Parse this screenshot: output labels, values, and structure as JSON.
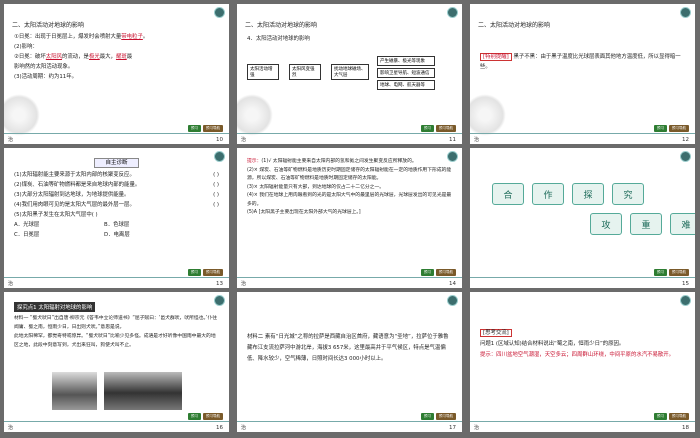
{
  "slides": [
    {
      "num": "10",
      "header": "二、太阳活动对地球的影响",
      "lines": [
        {
          "pre": "②日冕：出现于",
          "mid1": "",
          "post1": "   ，爆发时会喷射大量",
          "blank1": "带电粒子",
          "tail": "。"
        },
        {
          "pre": "(2)影响：",
          "mid1": "",
          "post1": "",
          "blank1": "",
          "tail": ""
        }
      ],
      "line2a": "①日冕：出现于日冕层上，爆发时会喷射大量",
      "line2a_red": "带电粒子",
      "line2b": "。",
      "line3": "(2)影响：",
      "line4a": "①扰乱",
      "line4_red1": "",
      "line4b": "",
      "line5a": "②日冕：破坏",
      "line5_red1": "太阳风",
      "line5b": "的流动，是",
      "line5_red2": "极光",
      "line5c": "最大，",
      "line5_red3": "耀斑",
      "line5d": "最",
      "line6": "影响然的太阳活动现象。",
      "line7": "(3)活动周期：约为11年。"
    },
    {
      "num": "11",
      "header": "二、太阳活动对地球的影响",
      "sub": "4．太阳活动对地球的影响",
      "boxes": [
        "太阳活动增强",
        "太阳风变强烈",
        "扰动地球磁场、大气层",
        "产生磁暴、极光等现象",
        "影响卫星导航、短波通信",
        "地球、电网、航天器等"
      ],
      "reds": [
        "磁暴",
        "短波通信",
        "航天器"
      ]
    },
    {
      "num": "12",
      "header": "二、太阳活动对地球的影响",
      "tag": "[特别提醒]",
      "text": "黑子不黑：由于黑子温度比光球层表面其他地方温度低，所以显得暗一些。"
    },
    {
      "num": "13",
      "title": "自主诊断",
      "items": [
        {
          "q": "(1)太阳辐射能主要来源于太阳内部的核聚变反应。",
          "a": "(   )"
        },
        {
          "q": "(2)煤炭、石油等矿物燃料都是来自地球内部的能量。",
          "a": "(   )"
        },
        {
          "q": "(3)大部分太阳辐射到达地球，为地球提供能量。",
          "a": "(   )"
        },
        {
          "q": "(4)我们用肉眼可见的是太阳大气层的最外层一层。",
          "a": "(   )"
        },
        {
          "q": "(5)太阳黑子发生在太阳大气层中(   )",
          "a": ""
        }
      ],
      "options": [
        "A．光球层",
        "B．色球层",
        "C．日冕层",
        "D．电离层"
      ]
    },
    {
      "num": "14",
      "label": "提示：",
      "paras": [
        "(1)√  太阳辐射能主要来自太阳内部的氢和氦之间发生聚变反应所释放的。",
        "(2)×  煤炭、石油等矿物燃料是地质历史时期固定储存的太阳辐射能在一定的地质作用下形成的能源，所以煤炭、石油等矿物燃料是地质时期固定储存的太阳能。",
        "(3)×  太阳辐射能量只有大部，到达地球的仅占二十二亿分之一。",
        "(4)×  我们在地球上用肉眼看到的光的是太阳大气中的最里层的光球层，光球层发出的可见光是最多的。",
        "(5)A  [太阳黑子主要出现在太阳外部大气的光球层上。]"
      ]
    },
    {
      "num": "15",
      "chars1": [
        "合",
        "作",
        "探",
        "究"
      ],
      "chars2": [
        "攻",
        "重",
        "难"
      ]
    },
    {
      "num": "16",
      "banner": "探究点1  太阳辐射对地球的影响",
      "lines": [
        "材料一  “蜀犬吠日”出自唐·柳宗元《答韦中立论师道书》“屈子赋曰：‘邑犬群吠，吠所怪也。’仆往闻庸、蜀之南，恒雨少日，日出则犬吠。”意思是说，",
        "此地太阳稀罕，都觉奇特或惊异。“蜀犬吠日”比喻少见多怪。成语是才好听像中国雨中最大的地区之地，此段中刻意写到，犬出来狂叫，狗使犬叫不止。"
      ]
    },
    {
      "num": "17",
      "text": "材料二  素有“日光城”之称的拉萨是西藏自治区首府，藏语意为“圣地”，拉萨位于雅鲁藏布江支流拉萨河中游北岸，海拔3 657米，这里最高并于平气候区，特点是气温偏低、降水较少，空气稀薄，日照时间长达3 000小时以上。"
    },
    {
      "num": "18",
      "tag": "[思考交流]",
      "q": "问题1  (区域认知)结合材料说出“蜀之南，恒雨少日”的原因。",
      "tip": "提示：四川盆地空气潮湿，天空多云；四周群山环绕，中间平原的水汽不易散开。"
    }
  ],
  "footer": {
    "left": "治",
    "btn_green": "预习",
    "btn_brown": "预习导航"
  }
}
